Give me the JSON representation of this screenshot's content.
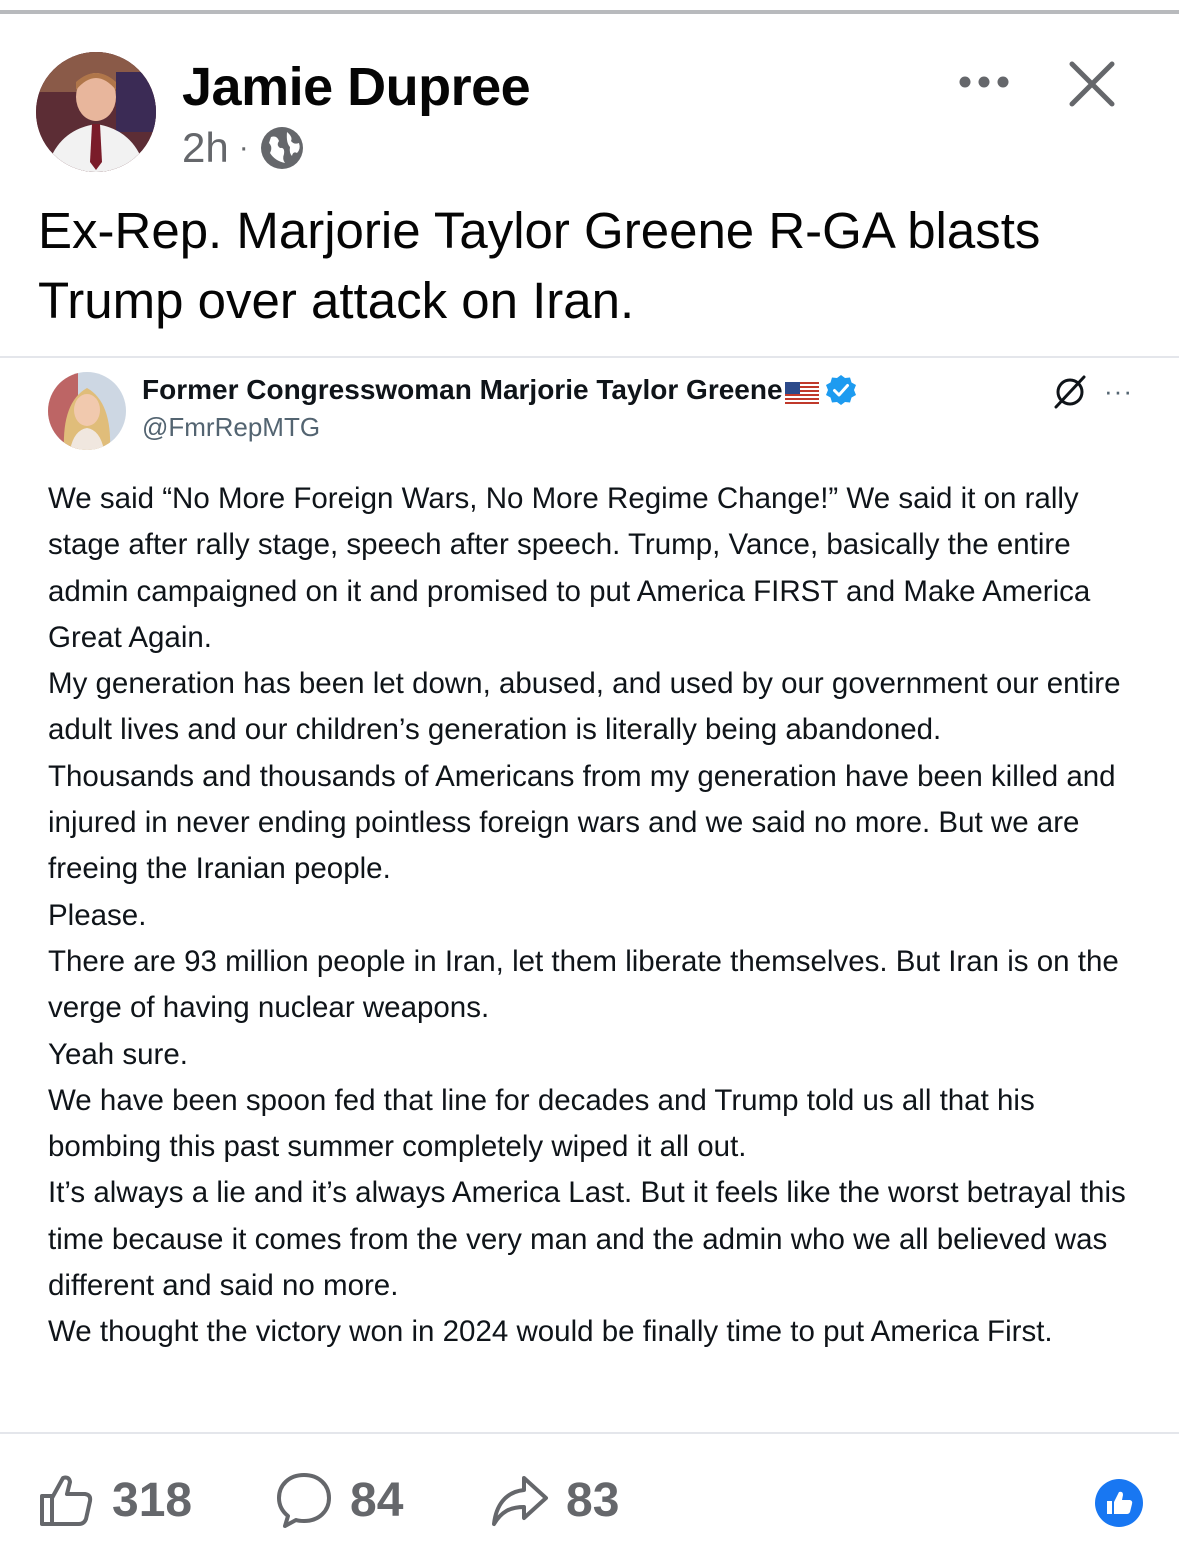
{
  "post": {
    "author": "Jamie Dupree",
    "time": "2h",
    "separator": "·",
    "audience_icon": "globe-icon",
    "text": "Ex-Rep. Marjorie Taylor Greene R-GA blasts Trump over attack on Iran."
  },
  "tweet": {
    "display_name": "Former Congresswoman Marjorie Taylor Greene",
    "handle": "@FmrRepMTG",
    "more_glyph": "···",
    "paragraphs": [
      "We said “No More Foreign Wars, No More Regime Change!” We said it on rally stage after rally stage, speech after speech. Trump, Vance, basically the entire admin campaigned on it and promised to put America FIRST and Make America Great Again.",
      "My generation has been let down, abused, and used by our government our entire adult lives and our children’s generation is literally being abandoned.",
      "Thousands and thousands of Americans from my generation have been killed and injured in never ending pointless foreign wars and we said no more. But we are freeing the Iranian people.",
      "Please.",
      "There are 93 million people in Iran, let them liberate themselves. But Iran is on the verge of having nuclear weapons.",
      "Yeah sure.",
      "We have been spoon fed that line for decades and Trump told us all that his bombing this past summer completely wiped it all out.",
      "It’s always a lie and it’s always America Last. But it feels like the worst betrayal this time because it comes from the very man and the admin who we all believed was different and said no more.",
      "We thought the victory won in 2024 would be finally time to put America First."
    ]
  },
  "actions": {
    "likes": "318",
    "comments": "84",
    "shares": "83"
  },
  "colors": {
    "meta_gray": "#65676b",
    "divider": "#e4e6eb",
    "fb_blue": "#1877f2",
    "verified_blue": "#1d9bf0"
  }
}
